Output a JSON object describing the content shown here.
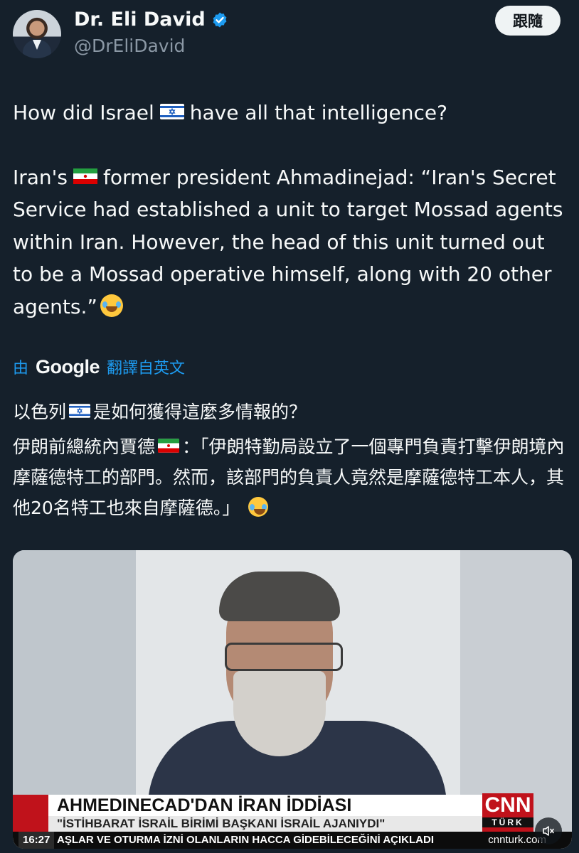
{
  "header": {
    "name": "Dr. Eli David",
    "handle": "@DrEliDavid",
    "follow_label": "跟隨"
  },
  "tweet": {
    "line1_a": "How did Israel",
    "line1_b": "have all that intelligence?",
    "line2_a": "Iran's",
    "line2_b": "former president Ahmadinejad: “Iran's Secret Service had established a unit to target Mossad agents within Iran. However, the head of this unit turned out to be a Mossad operative himself, along with 20 other agents.”"
  },
  "translation": {
    "by": "由",
    "provider": "Google",
    "from": "翻譯自英文",
    "line1_a": "以色列",
    "line1_b": "是如何獲得這麼多情報的？",
    "line2_a": "伊朗前總統內賈德",
    "line2_b": "：「伊朗特勤局設立了一個專門負責打擊伊朗境內摩薩德特工的部門。然而，該部門的負責人竟然是摩薩德特工本人，其他20名特工也來自摩薩德。」"
  },
  "media": {
    "headline": "AHMEDINECAD'DAN İRAN İDDİASI",
    "subheadline": "\"İSTİHBARAT İSRAİL BİRİMİ BAŞKANI İSRAİL AJANIYDI\"",
    "channel": "CNN",
    "channel_sub": "TÜRK",
    "ticker_time": "16:27",
    "ticker_text": "AŞLAR VE OTURMA İZNİ OLANLARIN HACCA GİDEBİLECEĞİNİ AÇIKLADI",
    "ticker_url": "cnnturk.com"
  },
  "colors": {
    "background": "#15202b",
    "accent": "#1d9bf0",
    "secondary_text": "#8b98a5"
  }
}
